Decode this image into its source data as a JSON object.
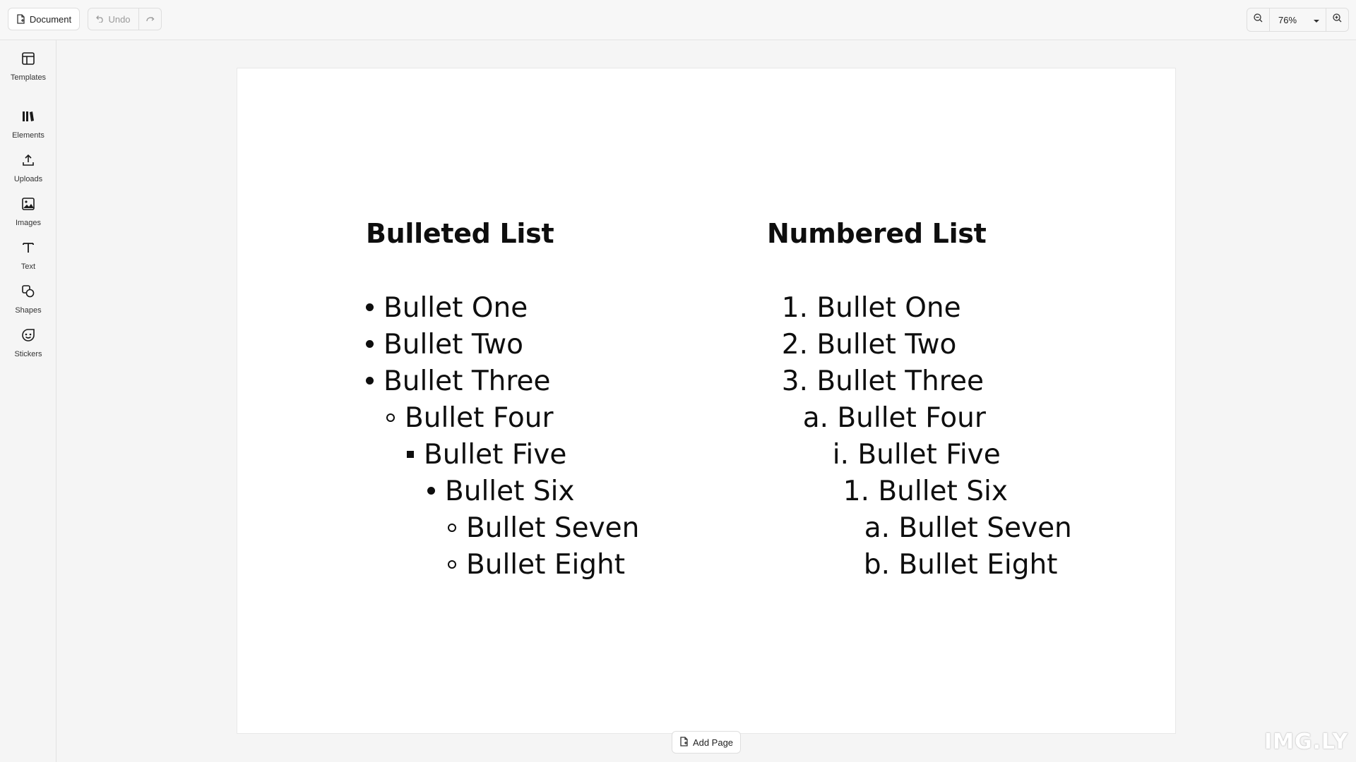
{
  "toolbar": {
    "document_label": "Document",
    "undo_label": "Undo",
    "zoom_value": "76%"
  },
  "sidebar": {
    "items": [
      {
        "label": "Templates",
        "icon": "templates-icon"
      },
      {
        "label": "Elements",
        "icon": "elements-icon"
      },
      {
        "label": "Uploads",
        "icon": "upload-icon"
      },
      {
        "label": "Images",
        "icon": "image-icon"
      },
      {
        "label": "Text",
        "icon": "text-icon"
      },
      {
        "label": "Shapes",
        "icon": "shapes-icon"
      },
      {
        "label": "Stickers",
        "icon": "sticker-icon"
      }
    ]
  },
  "canvas": {
    "bulleted": {
      "title": "Bulleted List",
      "items": [
        {
          "text": "Bullet One",
          "marker": "disc"
        },
        {
          "text": "Bullet Two",
          "marker": "disc"
        },
        {
          "text": "Bullet Three",
          "marker": "disc"
        },
        {
          "text": "Bullet Four",
          "marker": "circle"
        },
        {
          "text": "Bullet Five",
          "marker": "square"
        },
        {
          "text": "Bullet Six",
          "marker": "disc"
        },
        {
          "text": "Bullet Seven",
          "marker": "circle"
        },
        {
          "text": "Bullet Eight",
          "marker": "circle"
        }
      ]
    },
    "numbered": {
      "title": "Numbered List",
      "items": [
        {
          "text": "Bullet One",
          "marker": "1."
        },
        {
          "text": "Bullet Two",
          "marker": "2."
        },
        {
          "text": "Bullet Three",
          "marker": "3."
        },
        {
          "text": "Bullet Four",
          "marker": "a."
        },
        {
          "text": "Bullet Five",
          "marker": "i."
        },
        {
          "text": "Bullet Six",
          "marker": "1."
        },
        {
          "text": "Bullet Seven",
          "marker": "a."
        },
        {
          "text": "Bullet Eight",
          "marker": "b."
        }
      ]
    }
  },
  "footer": {
    "add_page_label": "Add Page",
    "watermark": "IMG.LY"
  }
}
